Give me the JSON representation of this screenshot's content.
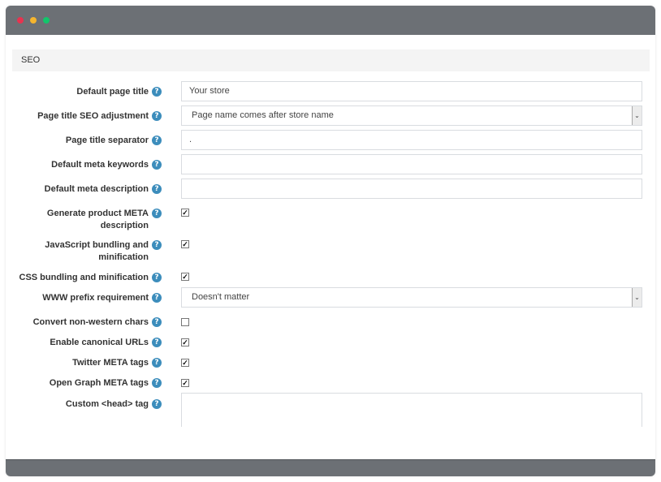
{
  "window": {
    "controls": [
      "close",
      "minimize",
      "maximize"
    ],
    "colors": {
      "close": "#e8334f",
      "minimize": "#f5b52e",
      "maximize": "#12c66b",
      "titlebar": "#6c7075",
      "help_icon": "#3c8dbc"
    }
  },
  "section": {
    "title": "SEO"
  },
  "help_icon_glyph": "?",
  "checkmark_glyph": "✓",
  "dropdown_glyph": "⌄",
  "fields": {
    "default_page_title": {
      "label": "Default page title",
      "value": "Your store"
    },
    "page_title_seo_adjustment": {
      "label": "Page title SEO adjustment",
      "selected": "Page name comes after store name"
    },
    "page_title_separator": {
      "label": "Page title separator",
      "value": "."
    },
    "default_meta_keywords": {
      "label": "Default meta keywords",
      "value": ""
    },
    "default_meta_description": {
      "label": "Default meta description",
      "value": ""
    },
    "generate_product_meta_description": {
      "label": "Generate product META description",
      "checked": true
    },
    "js_bundling": {
      "label": "JavaScript bundling and minification",
      "checked": true
    },
    "css_bundling": {
      "label": "CSS bundling and minification",
      "checked": true
    },
    "www_prefix_requirement": {
      "label": "WWW prefix requirement",
      "selected": "Doesn't matter"
    },
    "convert_non_western_chars": {
      "label": "Convert non-western chars",
      "checked": false
    },
    "enable_canonical_urls": {
      "label": "Enable canonical URLs",
      "checked": true
    },
    "twitter_meta_tags": {
      "label": "Twitter META tags",
      "checked": true
    },
    "open_graph_meta_tags": {
      "label": "Open Graph META tags",
      "checked": true
    },
    "custom_head_tag": {
      "label": "Custom <head> tag",
      "value": ""
    }
  }
}
